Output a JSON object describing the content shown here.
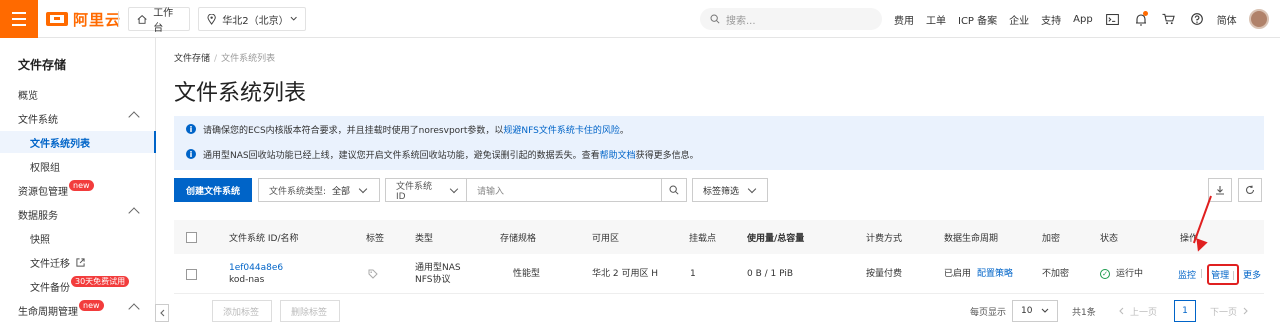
{
  "topbar": {
    "brand": "阿里云",
    "workbench": "工作台",
    "region": "华北2（北京）",
    "search_placeholder": "搜索...",
    "links": [
      "费用",
      "工单",
      "ICP 备案",
      "企业",
      "支持",
      "App"
    ],
    "language": "简体"
  },
  "sidebar": {
    "title": "文件存储",
    "items": [
      {
        "label": "概览"
      },
      {
        "label": "文件系统"
      },
      {
        "label": "文件系统列表"
      },
      {
        "label": "权限组"
      },
      {
        "label": "资源包管理",
        "badge": "new"
      },
      {
        "label": "数据服务"
      },
      {
        "label": "快照"
      },
      {
        "label": "文件迁移"
      },
      {
        "label": "文件备份",
        "badge": "30天免费试用"
      },
      {
        "label": "生命周期管理",
        "badge": "new"
      }
    ]
  },
  "breadcrumb": {
    "root": "文件存储",
    "current": "文件系统列表"
  },
  "page_title": "文件系统列表",
  "notices": [
    {
      "text": "请确保您的ECS内核版本符合要求，并且挂载时使用了noresvport参数，以",
      "link": "规避NFS文件系统卡住的风险",
      "tail": "。"
    },
    {
      "text": "通用型NAS回收站功能已经上线，建议您开启文件系统回收站功能，避免误删引起的数据丢失。查看",
      "link": "帮助文档",
      "tail": "获得更多信息。"
    }
  ],
  "toolbar": {
    "create_label": "创建文件系统",
    "type_filter_label": "文件系统类型:",
    "type_filter_value": "全部",
    "id_filter_label": "文件系统ID",
    "search_placeholder": "请输入",
    "tag_filter_label": "标签筛选"
  },
  "table": {
    "headers": [
      "文件系统 ID/名称",
      "标签",
      "类型",
      "存储规格",
      "可用区",
      "挂载点",
      "使用量/总容量",
      "计费方式",
      "数据生命周期",
      "加密",
      "状态",
      "操作"
    ],
    "rows": [
      {
        "id": "1ef044a8e6",
        "name": "kod-nas",
        "type_line1": "通用型NAS",
        "type_line2": "NFS协议",
        "spec": "性能型",
        "zone": "华北 2 可用区 H",
        "mounts": "1",
        "usage": "0 B / 1 PiB",
        "billing": "按量付费",
        "lifecycle_status": "已启用",
        "lifecycle_link": "配置策略",
        "encryption": "不加密",
        "status": "运行中",
        "ops": [
          "监控",
          "管理",
          "更多"
        ]
      }
    ]
  },
  "footer": {
    "add_tag": "添加标签",
    "remove_tag": "删除标签",
    "page_size_label": "每页显示",
    "page_size": "10",
    "total": "共1条",
    "prev": "上一页",
    "page": "1",
    "next": "下一页"
  },
  "colors": {
    "brand": "#ff6a00",
    "primary": "#0064c8",
    "annotation": "#e02020"
  }
}
